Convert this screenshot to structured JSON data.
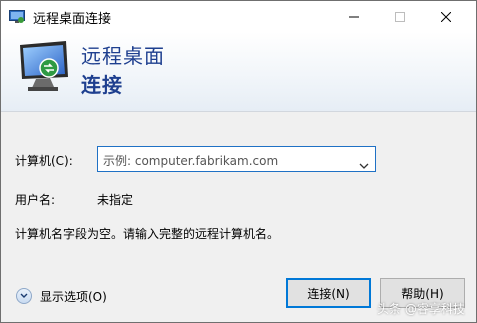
{
  "window": {
    "title": "远程桌面连接",
    "icon": "remote-desktop-icon",
    "controls": {
      "minimize": "minimize-icon",
      "maximize": "maximize-icon",
      "close": "close-icon"
    }
  },
  "header": {
    "line1": "远程桌面",
    "line2": "连接",
    "accent_color": "#1e3f8f"
  },
  "form": {
    "computer_label": "计算机(C):",
    "computer_placeholder": "示例: computer.fabrikam.com",
    "username_label": "用户名:",
    "username_value": "未指定",
    "hint": "计算机名字段为空。请输入完整的远程计算机名。"
  },
  "footer": {
    "show_options": "显示选项(O)",
    "connect_button": "连接(N)",
    "help_button": "帮助(H)",
    "watermark": "头条 @睿享科技"
  }
}
